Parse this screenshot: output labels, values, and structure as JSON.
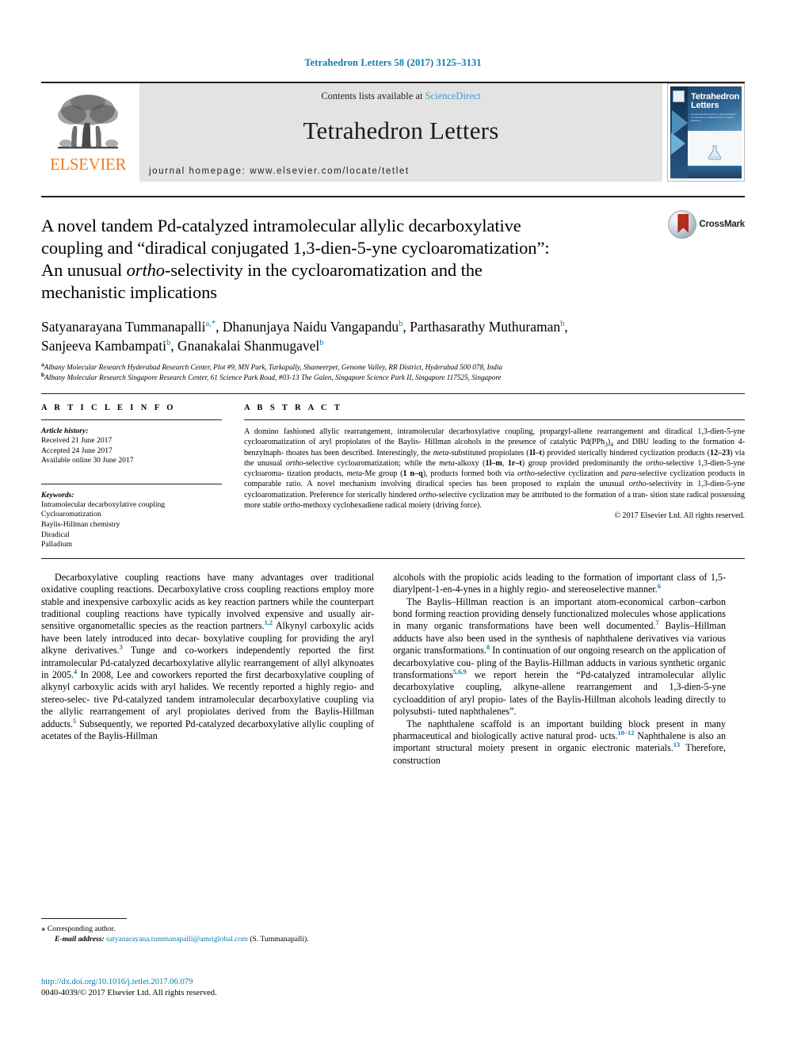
{
  "running_head": "Tetrahedron Letters 58 (2017) 3125–3131",
  "masthead": {
    "publisher_name": "ELSEVIER",
    "contents_prefix": "Contents lists available at ",
    "contents_link": "ScienceDirect",
    "journal_title": "Tetrahedron Letters",
    "homepage": "journal homepage: www.elsevier.com/locate/tetlet",
    "cover": {
      "line1": "Tetrahedron",
      "line2": "Letters",
      "subtitle": "An international journal for rapid publication of preliminary communications in organic chemistry"
    }
  },
  "title": {
    "line1": "A novel tandem Pd-catalyzed intramolecular allylic decarboxylative",
    "line2": "coupling and “diradical conjugated 1,3-dien-5-yne cycloaromatization”:",
    "line3_a": "An unusual ",
    "line3_em": "ortho",
    "line3_b": "-selectivity in the cycloaromatization and the",
    "line4": "mechanistic implications",
    "crossmark_label": "CrossMark"
  },
  "authors": {
    "list": [
      {
        "name": "Satyanarayana Tummanapalli",
        "marks": "a,*",
        "sep": ", "
      },
      {
        "name": "Dhanunjaya Naidu Vangapandu",
        "marks": "b",
        "sep": ", "
      },
      {
        "name": "Parthasarathy Muthuraman",
        "marks": "b",
        "sep": ","
      },
      {
        "name": "Sanjeeva Kambampati",
        "marks": "b",
        "sep": ", "
      },
      {
        "name": "Gnanakalai Shanmugavel",
        "marks": "b",
        "sep": ""
      }
    ],
    "affiliations": [
      {
        "mark": "a",
        "text": "Albany Molecular Research Hyderabad Research Center, Plot #9, MN Park, Turkapally, Shameerpet, Genome Valley, RR District, Hyderabad 500 078, India"
      },
      {
        "mark": "b",
        "text": "Albany Molecular Research Singapore Research Center, 61 Science Park Road, #03-13 The Galen, Singapore Science Park II, Singapore 117525, Singapore"
      }
    ]
  },
  "article_info": {
    "heading": "A R T I C L E   I N F O",
    "history_label": "Article history:",
    "history": [
      "Received 21 June 2017",
      "Accepted 24 June 2017",
      "Available online 30 June 2017"
    ],
    "keywords_label": "Keywords:",
    "keywords": [
      "Intramolecular decarboxylative coupling",
      "Cycloaromatization",
      "Baylis-Hillman chemistry",
      "Diradical",
      "Palladium"
    ]
  },
  "abstract": {
    "heading": "A B S T R A C T",
    "copyright": "© 2017 Elsevier Ltd. All rights reserved."
  },
  "body": {
    "left": {
      "p1_ref1": "1,2",
      "p1_ref2": "3",
      "p1_ref3": "4",
      "p1_ref4": "5"
    },
    "right": {
      "r_ref6": "6",
      "r_ref7": "7",
      "r_ref8": "8",
      "r_ref9": "5,6,9",
      "r_ref10": "10–12",
      "r_ref13": "13"
    }
  },
  "footnote": {
    "corresponding": "Corresponding author.",
    "email_label": "E-mail address:",
    "email": "satyanarayana.tummanapalli@amriglobal.com",
    "email_suffix": " (S. Tummanapalli)."
  },
  "footer": {
    "doi": "http://dx.doi.org/10.1016/j.tetlet.2017.06.079",
    "issn": "0040-4039/© 2017 Elsevier Ltd. All rights reserved."
  }
}
